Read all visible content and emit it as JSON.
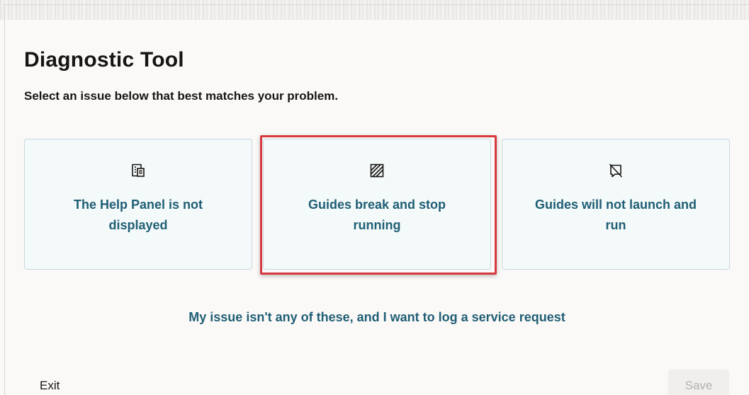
{
  "page": {
    "title": "Diagnostic Tool",
    "subtitle": "Select an issue below that best matches your problem."
  },
  "options": [
    {
      "label": "The Help Panel is not displayed",
      "icon": "help-panel-icon"
    },
    {
      "label": "Guides break and stop running",
      "icon": "striped-square-icon"
    },
    {
      "label": "Guides will not launch and run",
      "icon": "slashed-flag-icon"
    }
  ],
  "highlighted_option_index": 1,
  "service_request_link": "My issue isn't any of these, and I want to log a service request",
  "footer": {
    "exit_label": "Exit",
    "save_label": "Save"
  },
  "colors": {
    "accent_text": "#1f5e74",
    "highlight_border": "#d7393f",
    "card_background": "#f4f9fa"
  }
}
